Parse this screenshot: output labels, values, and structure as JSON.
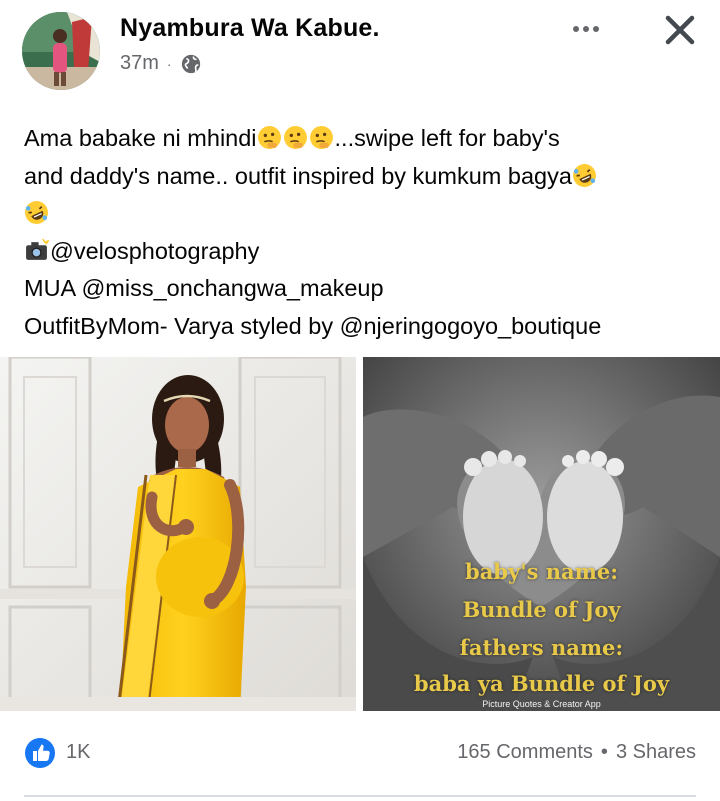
{
  "post": {
    "author": "Nyambura Wa Kabue.",
    "time": "37m",
    "separator": "·",
    "privacy_icon": "globe-icon",
    "more_icon": "more-options-icon",
    "close_icon": "close-icon"
  },
  "caption": {
    "line1": "Ama babake ni mhindi",
    "line1_end": "...swipe left for baby's",
    "line2": "and daddy's name.. outfit inspired by kumkum bagya",
    "line4": "@velosphotography",
    "line5": "MUA @miss_onchangwa_makeup",
    "line6": "OutfitByMom- Varya styled by @njeringogoyo_boutique",
    "emojis": [
      "thinking-face-emoji",
      "rolling-on-floor-laughing-emoji",
      "camera-flash-emoji"
    ]
  },
  "photo_right": {
    "line1": "baby's name:",
    "line2": "Bundle of Joy",
    "line3": "fathers name:",
    "line4": "baba ya Bundle of Joy",
    "credit": "Picture Quotes & Creator App"
  },
  "footer": {
    "like_icon": "like-icon",
    "likes": "1K",
    "comments": "165 Comments",
    "dot": "•",
    "shares": "3 Shares"
  },
  "colors": {
    "text": "#050505",
    "muted": "#65676b",
    "like_blue": "#1877f2",
    "saree_yellow": "#f5c518"
  }
}
